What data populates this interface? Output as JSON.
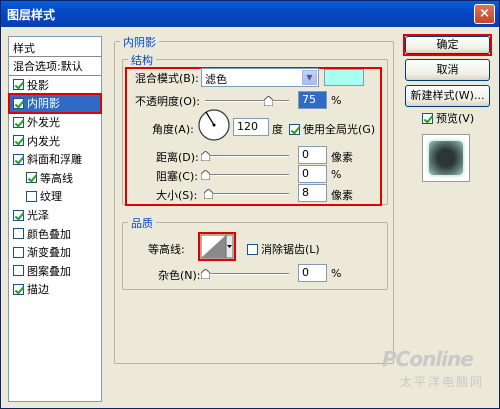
{
  "window": {
    "title": "图层样式",
    "close": "×"
  },
  "styles_list": {
    "header": "样式",
    "blend_options": "混合选项:默认",
    "items": [
      {
        "label": "投影",
        "checked": true
      },
      {
        "label": "内阴影",
        "checked": true,
        "selected": true
      },
      {
        "label": "外发光",
        "checked": true
      },
      {
        "label": "内发光",
        "checked": true
      },
      {
        "label": "斜面和浮雕",
        "checked": true
      },
      {
        "label": "等高线",
        "checked": true,
        "indent": true
      },
      {
        "label": "纹理",
        "checked": false,
        "indent": true
      },
      {
        "label": "光泽",
        "checked": true
      },
      {
        "label": "颜色叠加",
        "checked": false
      },
      {
        "label": "渐变叠加",
        "checked": false
      },
      {
        "label": "图案叠加",
        "checked": false
      },
      {
        "label": "描边",
        "checked": true
      }
    ]
  },
  "panel": {
    "title": "内阴影",
    "structure": {
      "title": "结构",
      "blend_mode_label": "混合模式(B):",
      "blend_mode_value": "滤色",
      "blend_color": "#a8fff0",
      "opacity_label": "不透明度(O):",
      "opacity_value": "75",
      "opacity_unit": "%",
      "opacity_fraction": 0.75,
      "angle_label": "角度(A):",
      "angle_value": "120",
      "angle_unit": "度",
      "global_light_label": "使用全局光(G)",
      "distance_label": "距离(D):",
      "distance_value": "0",
      "distance_unit": "像素",
      "choke_label": "阻塞(C):",
      "choke_value": "0",
      "choke_unit": "%",
      "size_label": "大小(S):",
      "size_value": "8",
      "size_unit": "像素"
    },
    "quality": {
      "title": "品质",
      "contour_label": "等高线:",
      "anti_alias_label": "消除锯齿(L)",
      "noise_label": "杂色(N):",
      "noise_value": "0",
      "noise_unit": "%"
    }
  },
  "buttons": {
    "ok": "确定",
    "cancel": "取消",
    "new_style": "新建样式(W)...",
    "preview": "预览(V)"
  },
  "watermark": {
    "brand": "PConline",
    "sub": "太平洋电脑网"
  },
  "colors": {
    "accent_red": "#e00000",
    "selection": "#316ac5",
    "group_title": "#0046d5"
  }
}
